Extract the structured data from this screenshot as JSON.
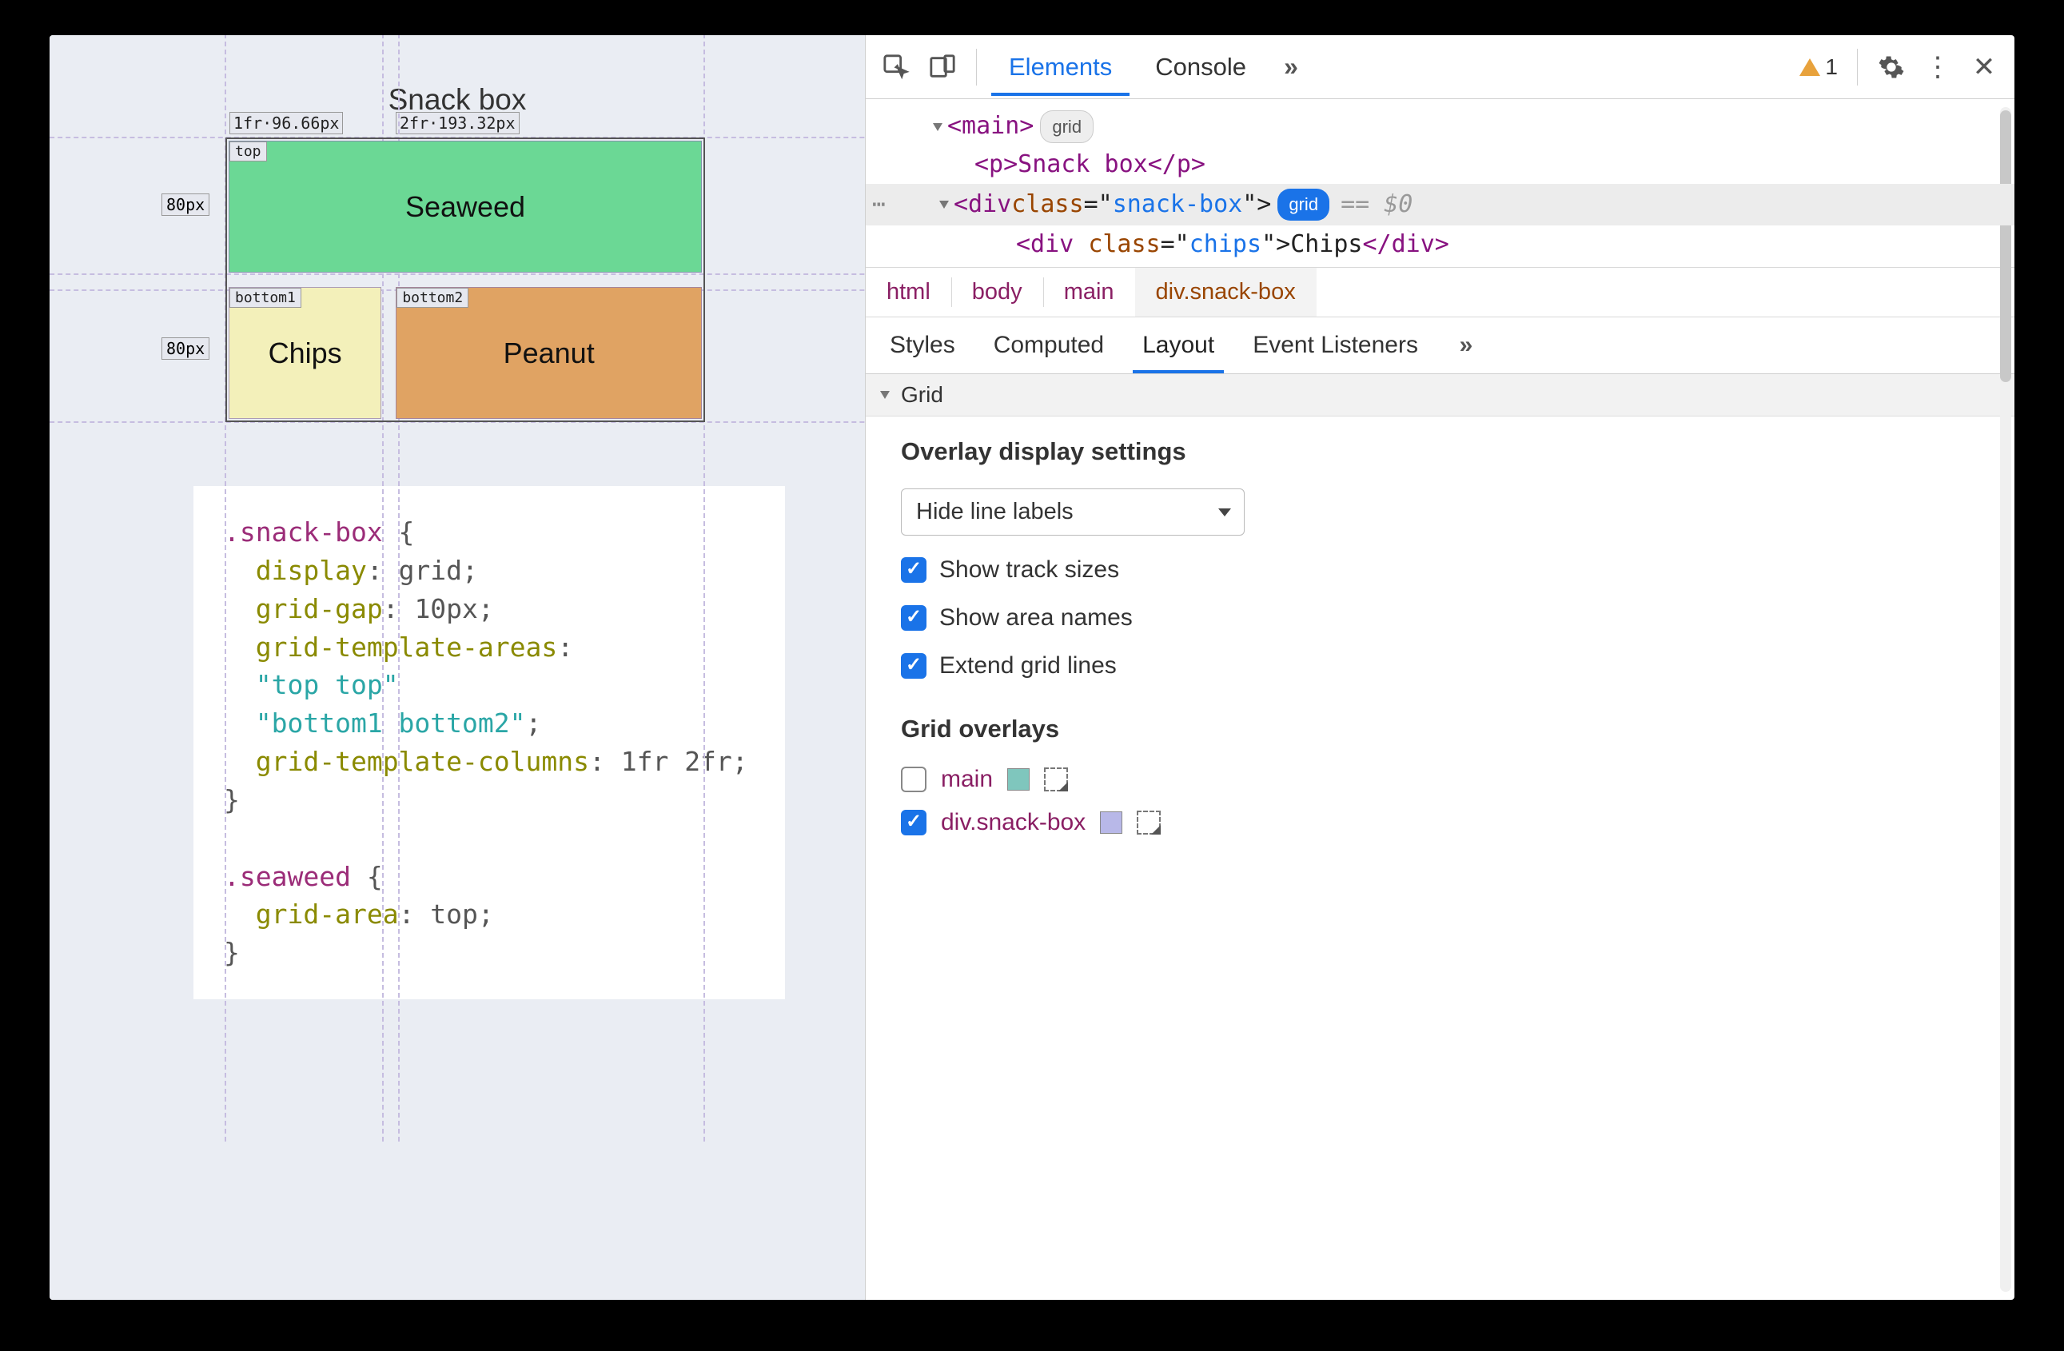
{
  "page": {
    "title": "Snack box",
    "cells": {
      "seaweed": "Seaweed",
      "chips": "Chips",
      "peanut": "Peanut"
    },
    "area_tags": {
      "top": "top",
      "bottom1": "bottom1",
      "bottom2": "bottom2"
    },
    "col_labels": {
      "c1": "1fr·96.66px",
      "c2": "2fr·193.32px"
    },
    "row_labels": {
      "r1": "80px",
      "r2": "80px"
    }
  },
  "code": {
    "snack_sel": ".snack-box",
    "brace_open": " {",
    "display_prop": "display",
    "display_val": ": grid;",
    "gap_prop": "grid-gap",
    "gap_val": ": 10px;",
    "areas_prop": "grid-template-areas",
    "areas_colon": ":",
    "areas_l1": "\"top top\"",
    "areas_l2": "\"bottom1 bottom2\"",
    "areas_semi": ";",
    "cols_prop": "grid-template-columns",
    "cols_val": ": 1fr 2fr;",
    "brace_close": "}",
    "seaweed_sel": ".seaweed",
    "area_prop": "grid-area",
    "area_val": ": top;"
  },
  "devtools": {
    "tabs": {
      "elements": "Elements",
      "console": "Console"
    },
    "warning_count": "1",
    "dom": {
      "main_open": "<main>",
      "main_pill": "grid",
      "p_line": "<p>Snack box</p>",
      "div_open_a": "<div ",
      "div_class_attr": "class",
      "div_class_eq": "=\"",
      "div_class_val": "snack-box",
      "div_close_q": "\">",
      "snack_pill": "grid",
      "eq0": "== $0",
      "chips_line_a": "<div ",
      "chips_attr": "class",
      "chips_eq": "=\"",
      "chips_val": "chips",
      "chips_q": "\">",
      "chips_txt": "Chips",
      "chips_close": "</div>"
    },
    "breadcrumb": [
      "html",
      "body",
      "main",
      "div.snack-box"
    ],
    "panel_tabs": [
      "Styles",
      "Computed",
      "Layout",
      "Event Listeners"
    ],
    "layout": {
      "section_title": "Grid",
      "overlay_heading": "Overlay display settings",
      "dropdown": "Hide line labels",
      "chk1": "Show track sizes",
      "chk2": "Show area names",
      "chk3": "Extend grid lines",
      "overlays_heading": "Grid overlays",
      "ov_main": "main",
      "ov_snack": "div.snack-box",
      "swatch_main": "#7fc6bd",
      "swatch_snack": "#b8b8e8"
    }
  }
}
